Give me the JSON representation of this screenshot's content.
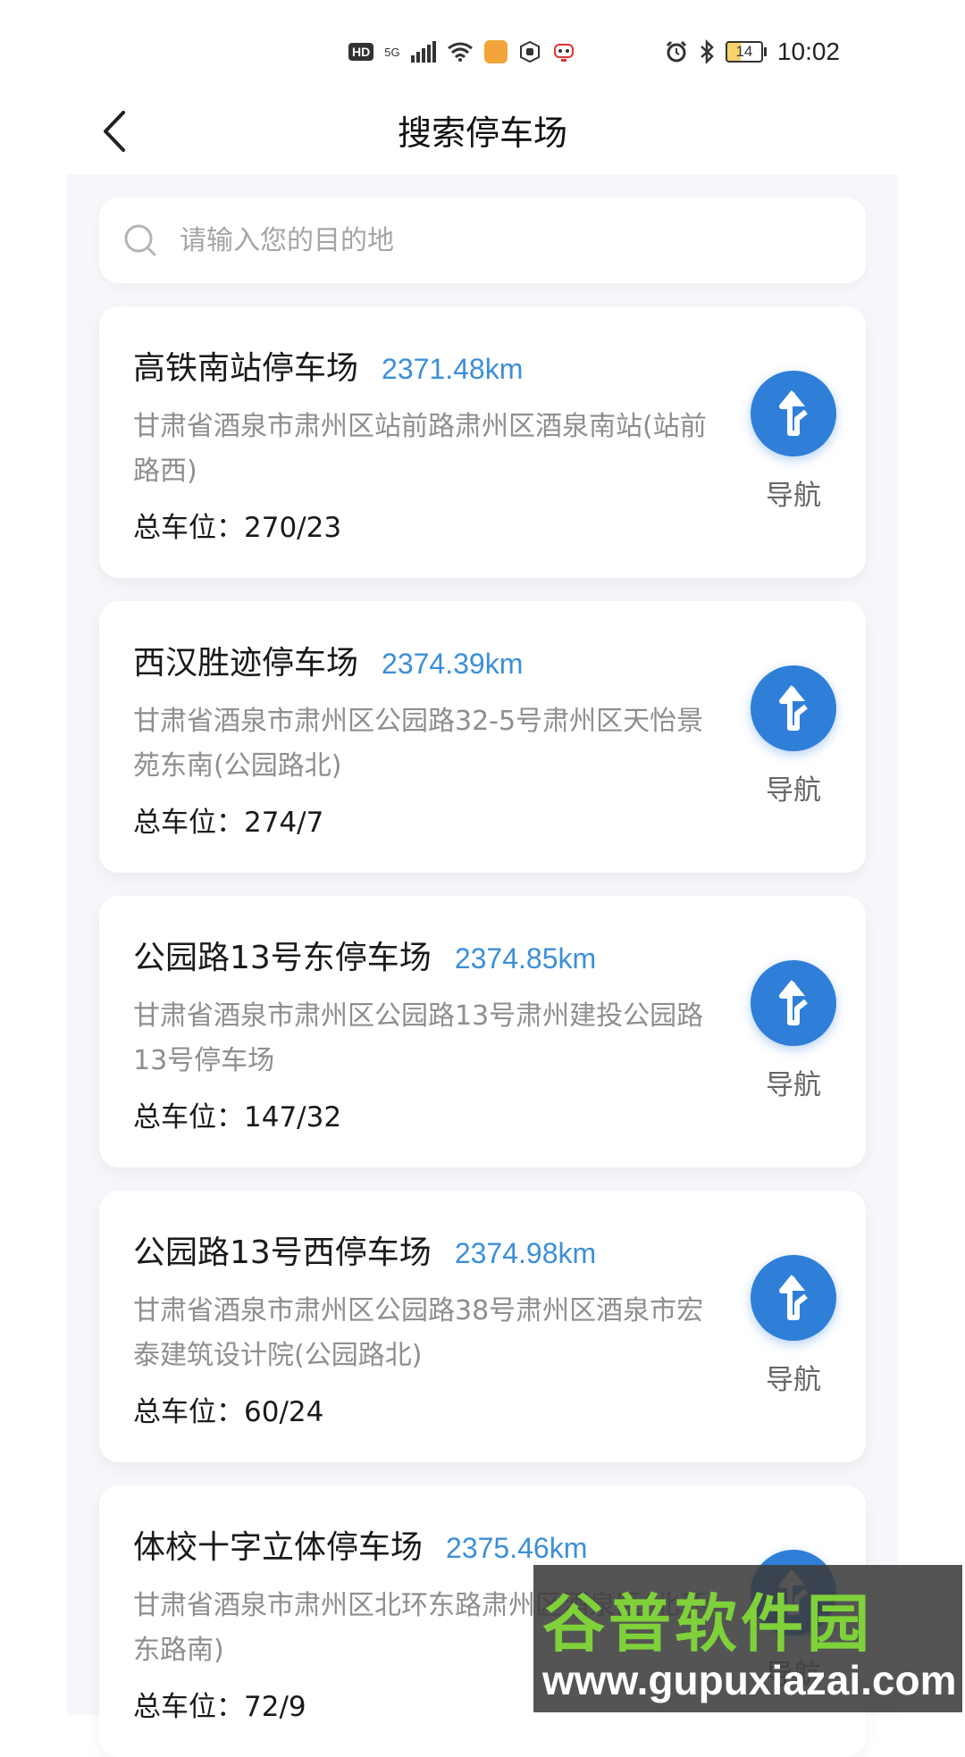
{
  "status_bar": {
    "hd": "HD",
    "network": "5G",
    "time": "10:02",
    "battery": "14"
  },
  "header": {
    "title": "搜索停车场"
  },
  "search": {
    "placeholder": "请输入您的目的地",
    "value": ""
  },
  "parkings": [
    {
      "name": "高铁南站停车场",
      "distance": "2371.48km",
      "address": "甘肃省酒泉市肃州区站前路肃州区酒泉南站(站前路西)",
      "slots": "总车位：270/23",
      "nav_label": "导航"
    },
    {
      "name": "西汉胜迹停车场",
      "distance": "2374.39km",
      "address": "甘肃省酒泉市肃州区公园路32-5号肃州区天怡景苑东南(公园路北)",
      "slots": "总车位：274/7",
      "nav_label": "导航"
    },
    {
      "name": "公园路13号东停车场",
      "distance": "2374.85km",
      "address": "甘肃省酒泉市肃州区公园路13号肃州建投公园路13号停车场",
      "slots": "总车位：147/32",
      "nav_label": "导航"
    },
    {
      "name": "公园路13号西停车场",
      "distance": "2374.98km",
      "address": "甘肃省酒泉市肃州区公园路38号肃州区酒泉市宏泰建筑设计院(公园路北)",
      "slots": "总车位：60/24",
      "nav_label": "导航"
    },
    {
      "name": "体校十字立体停车场",
      "distance": "2375.46km",
      "address": "甘肃省酒泉市肃州区北环东路肃州区酒泉区(北环东路南)",
      "slots": "总车位：72/9",
      "nav_label": "导航"
    }
  ],
  "watermark": {
    "brand": "谷普软件园",
    "url": "www.gupuxiazai.com"
  },
  "colors": {
    "accent": "#2f7fd9",
    "distance": "#3c8fd8",
    "panel_bg": "#f6f7fa"
  }
}
